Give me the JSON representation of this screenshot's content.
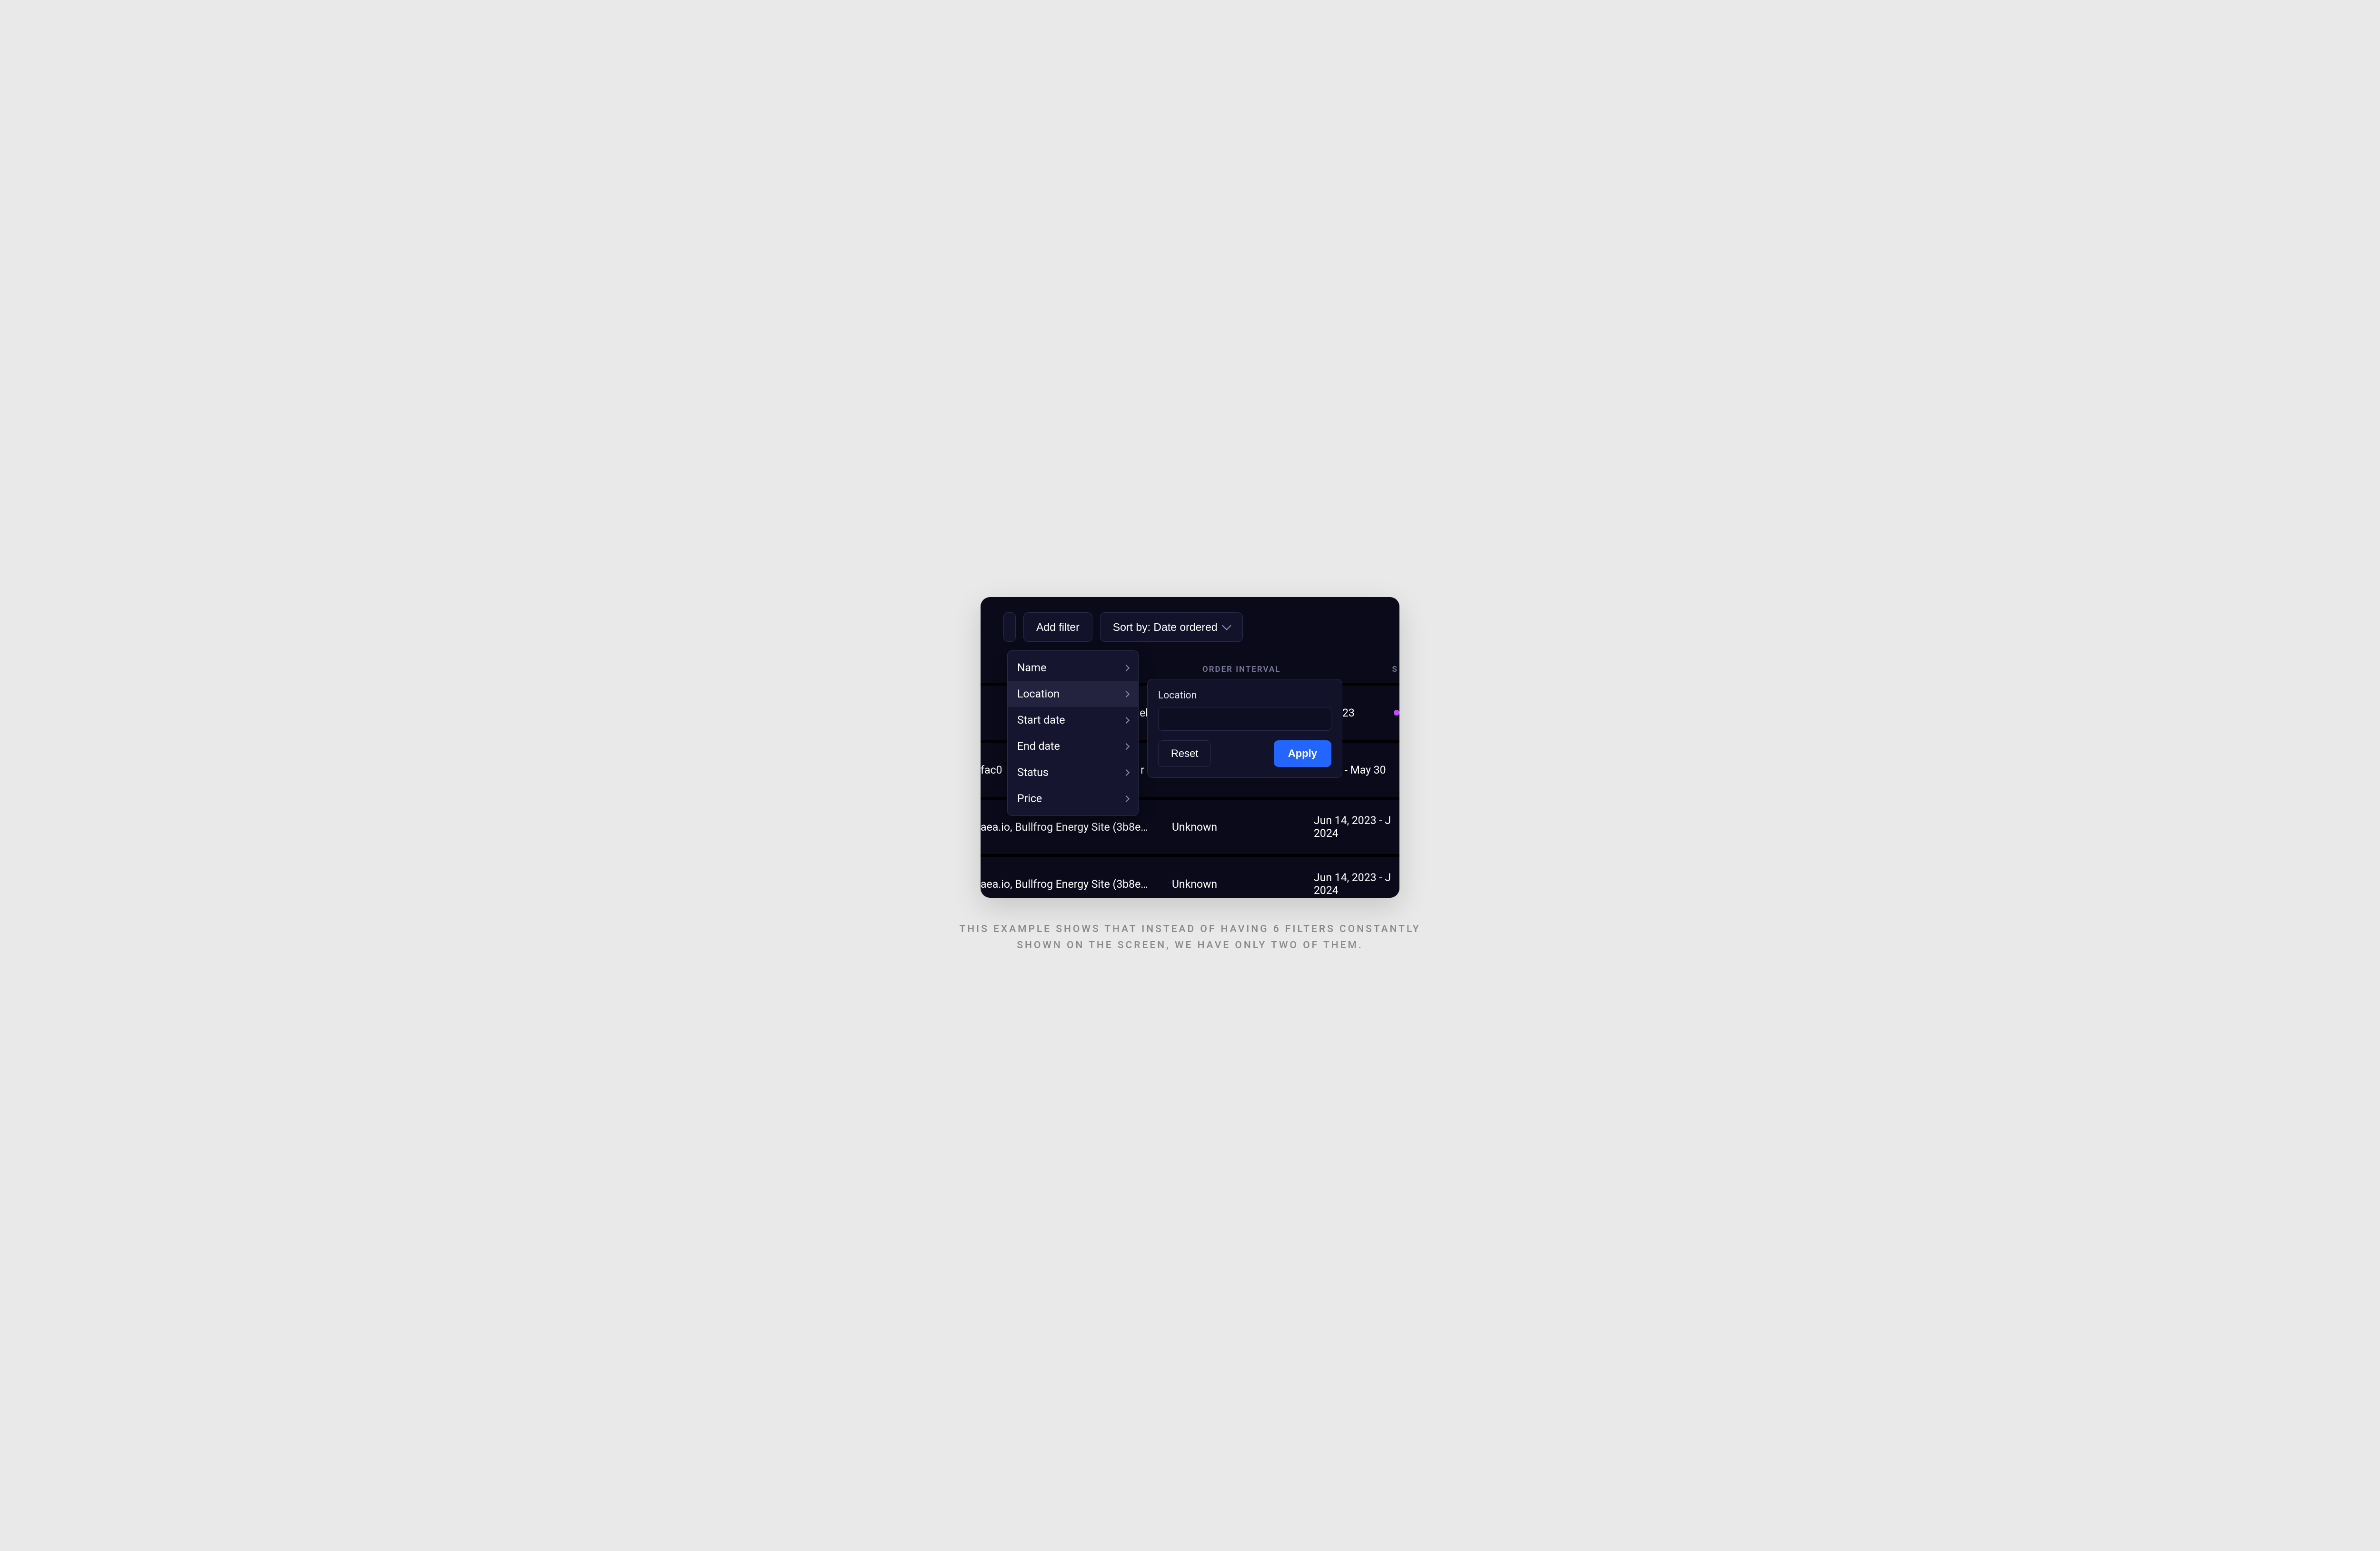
{
  "toolbar": {
    "add_filter_label": "Add filter",
    "sort_prefix": "Sort by: ",
    "sort_value": "Date ordered"
  },
  "table": {
    "headers": {
      "order_interval": "ORDER INTERVAL",
      "status_partial": "S"
    },
    "rows": [
      {
        "site_partial": "el",
        "type_partial": "",
        "interval": "23",
        "status_color": "#c946ff"
      },
      {
        "site_partial": "fac0",
        "type_partial": "r",
        "interval": "3 - May 30"
      },
      {
        "site_partial": "aea.io, Bullfrog Energy Site (3b8e…",
        "type": "Unknown",
        "interval": "Jun 14, 2023 - J",
        "interval_line2": "2024"
      },
      {
        "site_partial": "aea.io, Bullfrog Energy Site (3b8e…",
        "type": "Unknown",
        "interval": "Jun 14, 2023 - J",
        "interval_line2": "2024"
      }
    ]
  },
  "filter_menu": {
    "items": [
      {
        "label": "Name"
      },
      {
        "label": "Location",
        "active": true
      },
      {
        "label": "Start date"
      },
      {
        "label": "End date"
      },
      {
        "label": "Status"
      },
      {
        "label": "Price"
      }
    ]
  },
  "filter_panel": {
    "label": "Location",
    "input_value": "",
    "reset_label": "Reset",
    "apply_label": "Apply"
  },
  "caption": "THIS EXAMPLE SHOWS THAT INSTEAD OF HAVING 6 FILTERS CONSTANTLY SHOWN ON THE SCREEN, WE HAVE ONLY TWO OF THEM."
}
